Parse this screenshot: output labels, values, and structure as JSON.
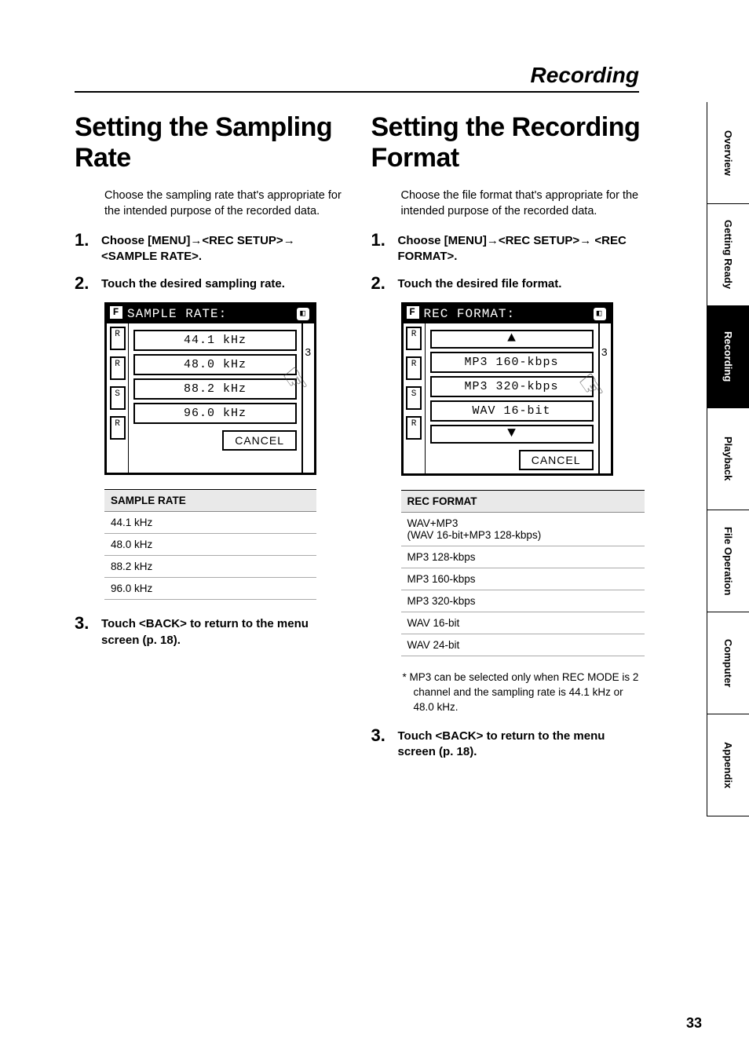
{
  "page": {
    "section_title": "Recording",
    "page_number": "33"
  },
  "tabs": {
    "t0": "Overview",
    "t1": "Getting Ready",
    "t2": "Recording",
    "t3": "Playback",
    "t4": "File Operation",
    "t5": "Computer",
    "t6": "Appendix"
  },
  "left": {
    "h1": "Setting the Sampling Rate",
    "intro": "Choose the sampling rate that's appropriate for the intended purpose of the recorded data.",
    "step1_a": "Choose [MENU]",
    "step1_b": "<REC SETUP>",
    "step1_c": "<SAMPLE RATE>.",
    "step2": "Touch the desired sampling rate.",
    "lcd_title": "SAMPLE RATE:",
    "lcd_opts": {
      "o0": "44.1 kHz",
      "o1": "48.0 kHz",
      "o2": "88.2 kHz",
      "o3": "96.0 kHz"
    },
    "cancel": "CANCEL",
    "table_header": "SAMPLE RATE",
    "table_rows": {
      "r0": "44.1 kHz",
      "r1": "48.0 kHz",
      "r2": "88.2 kHz",
      "r3": "96.0 kHz"
    },
    "step3": "Touch <BACK> to return to the menu screen (p. 18)."
  },
  "right": {
    "h1": "Setting the Recording Format",
    "intro": "Choose the file format that's appropriate for the intended purpose of the recorded data.",
    "step1_a": "Choose [MENU]",
    "step1_b": "<REC SETUP>",
    "step1_c": "<REC FORMAT>.",
    "step2": "Touch the desired file format.",
    "lcd_title": "REC FORMAT:",
    "lcd_opts": {
      "o0": "MP3 160-kbps",
      "o1": "MP3 320-kbps",
      "o2": "WAV 16-bit"
    },
    "cancel": "CANCEL",
    "table_header": "REC FORMAT",
    "table_rows": {
      "r0": "WAV+MP3",
      "r0b": "(WAV 16-bit+MP3 128-kbps)",
      "r1": "MP3 128-kbps",
      "r2": "MP3 160-kbps",
      "r3": "MP3 320-kbps",
      "r4": "WAV 16-bit",
      "r5": "WAV 24-bit"
    },
    "footnote": "*  MP3 can be selected only when REC MODE is 2 channel and the sampling rate is 44.1 kHz or 48.0 kHz.",
    "step3": "Touch <BACK> to return to the menu screen (p. 18)."
  },
  "glyphs": {
    "arrow": "→"
  }
}
